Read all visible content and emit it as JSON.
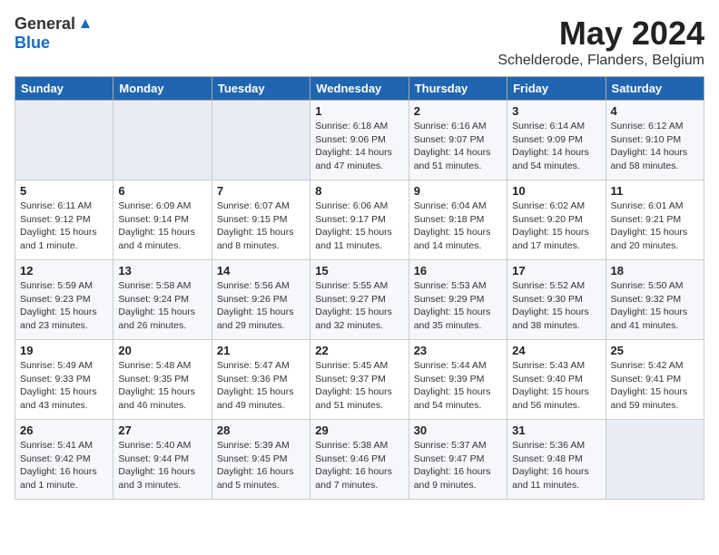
{
  "logo": {
    "general": "General",
    "blue": "Blue"
  },
  "title": "May 2024",
  "location": "Schelderode, Flanders, Belgium",
  "days_header": [
    "Sunday",
    "Monday",
    "Tuesday",
    "Wednesday",
    "Thursday",
    "Friday",
    "Saturday"
  ],
  "weeks": [
    [
      {
        "day": "",
        "content": ""
      },
      {
        "day": "",
        "content": ""
      },
      {
        "day": "",
        "content": ""
      },
      {
        "day": "1",
        "content": "Sunrise: 6:18 AM\nSunset: 9:06 PM\nDaylight: 14 hours and 47 minutes."
      },
      {
        "day": "2",
        "content": "Sunrise: 6:16 AM\nSunset: 9:07 PM\nDaylight: 14 hours and 51 minutes."
      },
      {
        "day": "3",
        "content": "Sunrise: 6:14 AM\nSunset: 9:09 PM\nDaylight: 14 hours and 54 minutes."
      },
      {
        "day": "4",
        "content": "Sunrise: 6:12 AM\nSunset: 9:10 PM\nDaylight: 14 hours and 58 minutes."
      }
    ],
    [
      {
        "day": "5",
        "content": "Sunrise: 6:11 AM\nSunset: 9:12 PM\nDaylight: 15 hours and 1 minute."
      },
      {
        "day": "6",
        "content": "Sunrise: 6:09 AM\nSunset: 9:14 PM\nDaylight: 15 hours and 4 minutes."
      },
      {
        "day": "7",
        "content": "Sunrise: 6:07 AM\nSunset: 9:15 PM\nDaylight: 15 hours and 8 minutes."
      },
      {
        "day": "8",
        "content": "Sunrise: 6:06 AM\nSunset: 9:17 PM\nDaylight: 15 hours and 11 minutes."
      },
      {
        "day": "9",
        "content": "Sunrise: 6:04 AM\nSunset: 9:18 PM\nDaylight: 15 hours and 14 minutes."
      },
      {
        "day": "10",
        "content": "Sunrise: 6:02 AM\nSunset: 9:20 PM\nDaylight: 15 hours and 17 minutes."
      },
      {
        "day": "11",
        "content": "Sunrise: 6:01 AM\nSunset: 9:21 PM\nDaylight: 15 hours and 20 minutes."
      }
    ],
    [
      {
        "day": "12",
        "content": "Sunrise: 5:59 AM\nSunset: 9:23 PM\nDaylight: 15 hours and 23 minutes."
      },
      {
        "day": "13",
        "content": "Sunrise: 5:58 AM\nSunset: 9:24 PM\nDaylight: 15 hours and 26 minutes."
      },
      {
        "day": "14",
        "content": "Sunrise: 5:56 AM\nSunset: 9:26 PM\nDaylight: 15 hours and 29 minutes."
      },
      {
        "day": "15",
        "content": "Sunrise: 5:55 AM\nSunset: 9:27 PM\nDaylight: 15 hours and 32 minutes."
      },
      {
        "day": "16",
        "content": "Sunrise: 5:53 AM\nSunset: 9:29 PM\nDaylight: 15 hours and 35 minutes."
      },
      {
        "day": "17",
        "content": "Sunrise: 5:52 AM\nSunset: 9:30 PM\nDaylight: 15 hours and 38 minutes."
      },
      {
        "day": "18",
        "content": "Sunrise: 5:50 AM\nSunset: 9:32 PM\nDaylight: 15 hours and 41 minutes."
      }
    ],
    [
      {
        "day": "19",
        "content": "Sunrise: 5:49 AM\nSunset: 9:33 PM\nDaylight: 15 hours and 43 minutes."
      },
      {
        "day": "20",
        "content": "Sunrise: 5:48 AM\nSunset: 9:35 PM\nDaylight: 15 hours and 46 minutes."
      },
      {
        "day": "21",
        "content": "Sunrise: 5:47 AM\nSunset: 9:36 PM\nDaylight: 15 hours and 49 minutes."
      },
      {
        "day": "22",
        "content": "Sunrise: 5:45 AM\nSunset: 9:37 PM\nDaylight: 15 hours and 51 minutes."
      },
      {
        "day": "23",
        "content": "Sunrise: 5:44 AM\nSunset: 9:39 PM\nDaylight: 15 hours and 54 minutes."
      },
      {
        "day": "24",
        "content": "Sunrise: 5:43 AM\nSunset: 9:40 PM\nDaylight: 15 hours and 56 minutes."
      },
      {
        "day": "25",
        "content": "Sunrise: 5:42 AM\nSunset: 9:41 PM\nDaylight: 15 hours and 59 minutes."
      }
    ],
    [
      {
        "day": "26",
        "content": "Sunrise: 5:41 AM\nSunset: 9:42 PM\nDaylight: 16 hours and 1 minute."
      },
      {
        "day": "27",
        "content": "Sunrise: 5:40 AM\nSunset: 9:44 PM\nDaylight: 16 hours and 3 minutes."
      },
      {
        "day": "28",
        "content": "Sunrise: 5:39 AM\nSunset: 9:45 PM\nDaylight: 16 hours and 5 minutes."
      },
      {
        "day": "29",
        "content": "Sunrise: 5:38 AM\nSunset: 9:46 PM\nDaylight: 16 hours and 7 minutes."
      },
      {
        "day": "30",
        "content": "Sunrise: 5:37 AM\nSunset: 9:47 PM\nDaylight: 16 hours and 9 minutes."
      },
      {
        "day": "31",
        "content": "Sunrise: 5:36 AM\nSunset: 9:48 PM\nDaylight: 16 hours and 11 minutes."
      },
      {
        "day": "",
        "content": ""
      }
    ]
  ]
}
